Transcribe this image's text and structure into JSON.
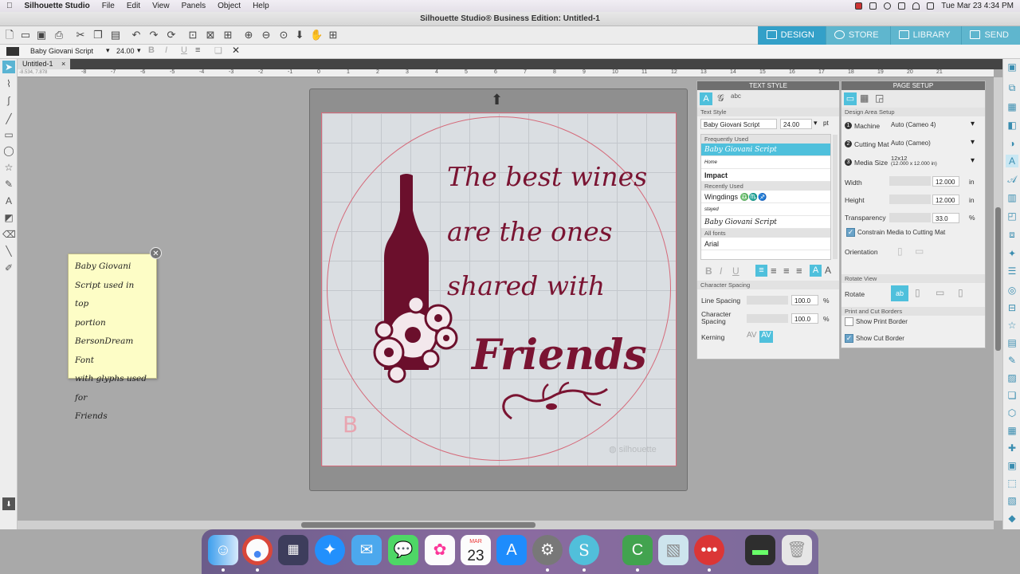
{
  "menubar": {
    "app": "Silhouette Studio",
    "items": [
      "File",
      "Edit",
      "View",
      "Panels",
      "Object",
      "Help"
    ],
    "clock": "Tue Mar 23  4:34 PM"
  },
  "window": {
    "title": "Silhouette Studio® Business Edition: Untitled-1"
  },
  "nav": {
    "design": "DESIGN",
    "store": "STORE",
    "library": "LIBRARY",
    "send": "SEND"
  },
  "fontbar": {
    "font": "Baby Giovani Script",
    "size": "24.00",
    "bold": "B",
    "italic": "I",
    "underline": "U"
  },
  "doc": {
    "tab": "Untitled-1",
    "close": "×",
    "coords": "-8.534, 7.878"
  },
  "ruler": {
    "ticks": [
      "-8",
      "-7",
      "-6",
      "-5",
      "-4",
      "-3",
      "-2",
      "-1",
      "0",
      "1",
      "2",
      "3",
      "4",
      "5",
      "6",
      "7",
      "8",
      "9",
      "10",
      "11",
      "12",
      "13",
      "14",
      "15",
      "16",
      "17",
      "18",
      "19",
      "20",
      "21"
    ]
  },
  "design": {
    "line1": "The best wines",
    "line2": "are the ones",
    "line3": "shared with",
    "line4": "Friends",
    "mat_letter": "B",
    "watermark": "silhouette"
  },
  "note": {
    "text": [
      "Baby Giovani",
      "Script used in top",
      "portion",
      "BersonDream Font",
      "with glyphs used for",
      "Friends"
    ]
  },
  "text_style": {
    "header": "TEXT STYLE",
    "section": "Text Style",
    "font": "Baby Giovani Script",
    "size": "24.00",
    "unit": "pt",
    "frequently_used": "Frequently Used",
    "frequent_fonts": [
      "Baby Giovani Script",
      "Home",
      "Impact"
    ],
    "recently_used": "Recently Used",
    "recent_fonts": [
      "Wingdings",
      "stayed",
      "Baby Giovani Script"
    ],
    "wingdings_glyphs": "♎♏♐",
    "all_fonts": "All fonts",
    "all_first": "Arial",
    "char_spacing": "Character Spacing",
    "line_spacing_label": "Line Spacing",
    "line_spacing": "100.0",
    "char_spacing_label": "Character Spacing",
    "char_value": "100.0",
    "percent": "%",
    "kerning": "Kerning",
    "kern_glyph": "AV"
  },
  "page_setup": {
    "header": "PAGE SETUP",
    "section": "Design Area Setup",
    "machine_label": "Machine",
    "machine": "Auto (Cameo 4)",
    "mat_label": "Cutting Mat",
    "mat": "Auto (Cameo)",
    "media_label": "Media Size",
    "media": "12x12",
    "media_sub": "(12.000 x 12.000 in)",
    "width_label": "Width",
    "width": "12.000",
    "height_label": "Height",
    "height": "12.000",
    "unit": "in",
    "transparency_label": "Transparency",
    "transparency": "33.0",
    "pct": "%",
    "constrain": "Constrain Media to Cutting Mat",
    "orientation": "Orientation",
    "rotate_view": "Rotate View",
    "rotate": "Rotate",
    "print_cut": "Print and Cut Borders",
    "show_print": "Show Print Border",
    "show_cut": "Show Cut Border"
  },
  "dock": {
    "calendar_month": "MAR",
    "calendar_day": "23"
  },
  "colors": {
    "accent": "#33a0c8",
    "wine": "#7a1432",
    "mat_line": "#d56a7a"
  }
}
